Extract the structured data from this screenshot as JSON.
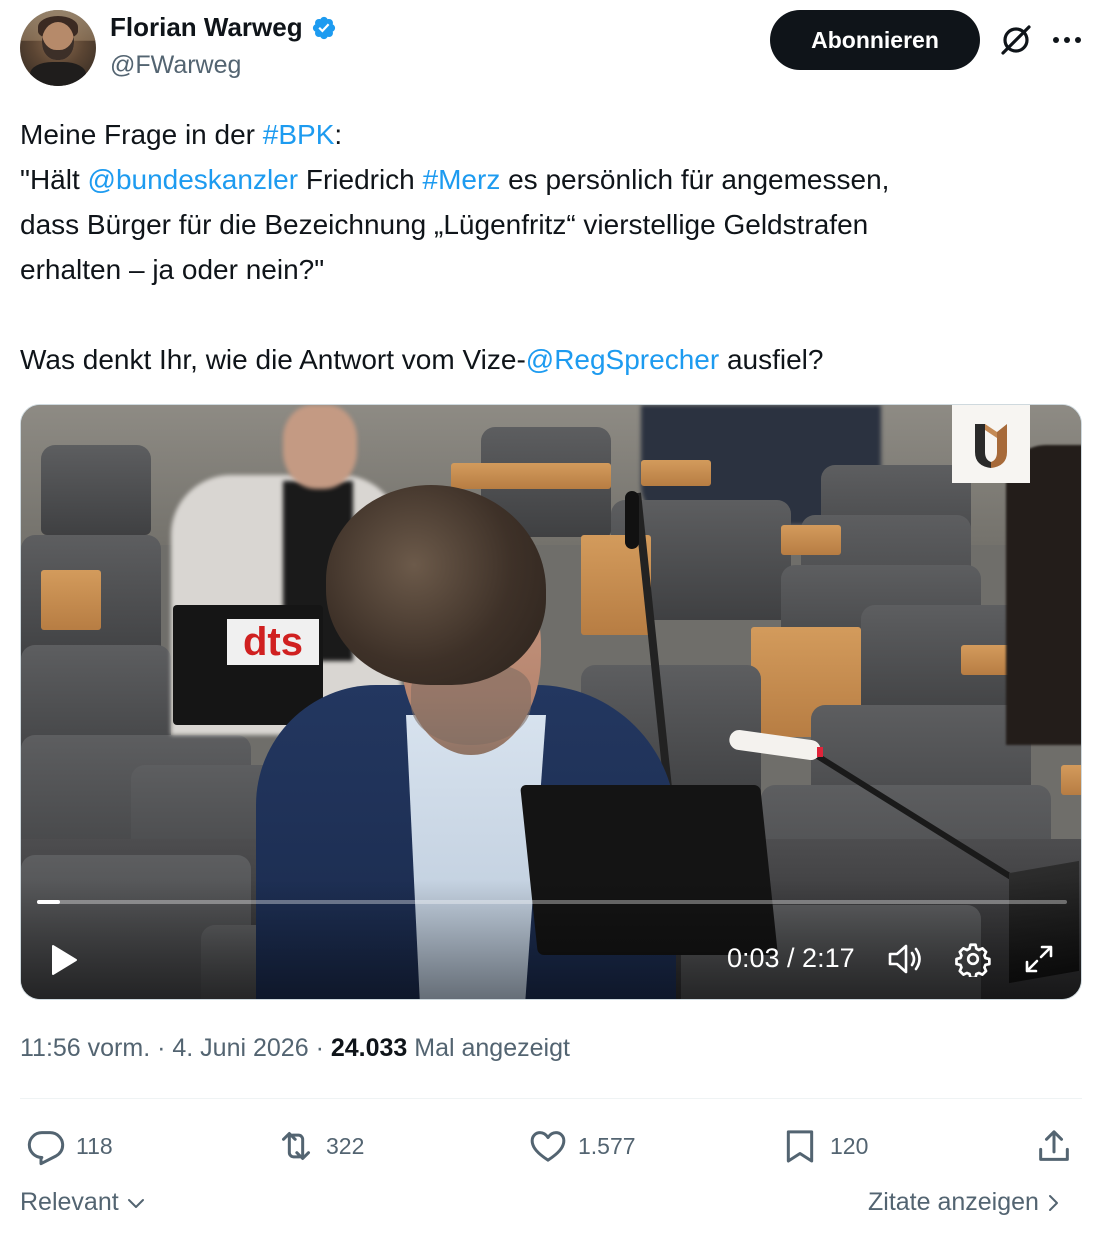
{
  "author": {
    "display_name": "Florian Warweg",
    "handle": "@FWarweg",
    "verified": true
  },
  "header": {
    "follow_label": "Abonnieren"
  },
  "tweet": {
    "line1_pre": "Meine Frage in der ",
    "line1_tag": "#BPK",
    "line1_post": ":",
    "line2_pre": "\"Hält ",
    "line2_mention": "@bundeskanzler",
    "line2_mid": " Friedrich ",
    "line2_tag": "#Merz",
    "line2_post": " es persönlich für angemessen,",
    "line3": "dass Bürger für die Bezeichnung „Lügenfritz“ vierstellige Geldstrafen",
    "line4": "erhalten – ja oder nein?\"",
    "line5_pre": "Was denkt Ihr, wie die Antwort vom Vize-",
    "line5_mention": "@RegSprecher",
    "line5_post": " ausfiel?"
  },
  "video": {
    "sign_text": "dts",
    "time_display": "0:03 / 2:17",
    "progress_fraction": 0.022
  },
  "meta": {
    "time": "11:56 vorm.",
    "date": "4. Juni 2026",
    "views_count": "24.033",
    "views_label": "Mal angezeigt"
  },
  "actions": {
    "replies": "118",
    "reposts": "322",
    "likes": "1.577",
    "bookmarks": "120"
  },
  "footer": {
    "sort_label": "Relevant",
    "quotes_label": "Zitate anzeigen"
  },
  "colors": {
    "link": "#1d9bf0",
    "text": "#0f1419",
    "muted": "#536471",
    "button_bg": "#0f1419"
  }
}
